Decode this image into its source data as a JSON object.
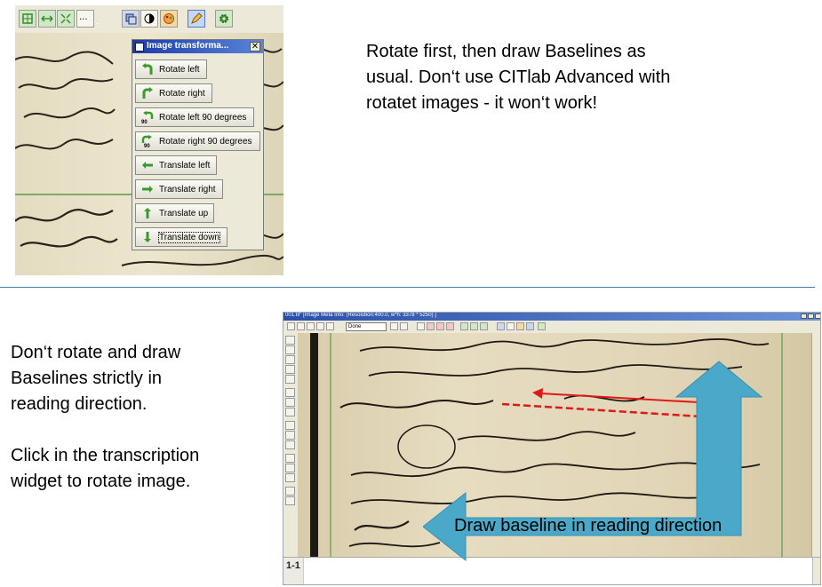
{
  "top": {
    "dialog": {
      "title": "Image transforma...",
      "close": "✕",
      "buttons": [
        {
          "label": "Rotate left",
          "icon": "rotate-left-icon"
        },
        {
          "label": "Rotate right",
          "icon": "rotate-right-icon"
        },
        {
          "label": "Rotate left 90 degrees",
          "icon": "rotate-left-90-icon",
          "badge": "90"
        },
        {
          "label": "Rotate right 90 degrees",
          "icon": "rotate-right-90-icon",
          "badge": "90"
        },
        {
          "label": "Translate left",
          "icon": "arrow-left-icon"
        },
        {
          "label": "Translate right",
          "icon": "arrow-right-icon"
        },
        {
          "label": "Translate up",
          "icon": "arrow-up-icon"
        },
        {
          "label": "Translate down",
          "icon": "arrow-down-icon"
        }
      ]
    },
    "toolbar_more": "...",
    "note": [
      "Rotate first, then draw Baselines as",
      "usual. Don‘t use CITlab Advanced with",
      "rotatet images - it won‘t work!"
    ]
  },
  "bottom": {
    "note1": [
      "Don‘t rotate and draw",
      "Baselines strictly in",
      "reading direction."
    ],
    "note2": [
      "Click in the transcription",
      "widget to rotate image."
    ],
    "app": {
      "title": "001.tif\" [Image Meta Info: (Resolution:400.0, w*h: 3378 * 5250) ]",
      "status_combo": "Done",
      "line_label": "1-1"
    },
    "arrow_label": "Draw baseline in reading direction"
  },
  "colors": {
    "arrow": "#4aa8c8",
    "baseline_red": "#e01818",
    "divider": "#4a7ea8",
    "green_icon": "#4a9a3a"
  }
}
